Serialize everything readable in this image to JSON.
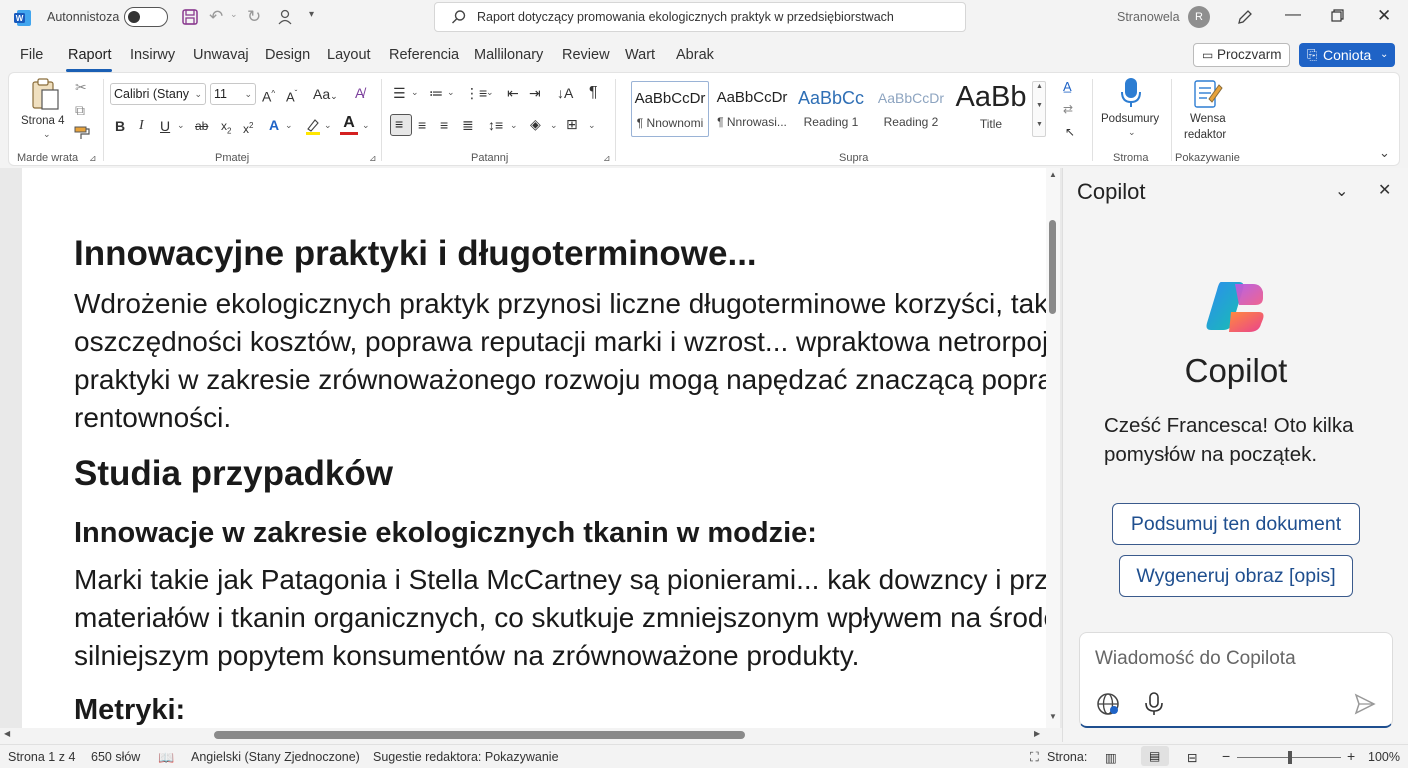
{
  "titlebar": {
    "autosave_label": "Autonnistoza",
    "search_text": "Raport dotyczący promowania ekologicznych praktyk w przedsiębiorstwach",
    "account_label": "Stranowela",
    "avatar_initial": "R"
  },
  "menu": {
    "tabs": [
      "File",
      "Raport",
      "Insirwy",
      "Unwavaj",
      "Design",
      "Layout",
      "Referencia",
      "Mallilonary",
      "Review",
      "Wart",
      "Abrak"
    ],
    "active_tab": "Raport",
    "comments_label": "Proczvarm",
    "share_label": "Coniota"
  },
  "ribbon": {
    "clipboard": {
      "paste_label": "Strona 4",
      "group_label": "Marde wrata"
    },
    "font": {
      "name": "Calibri (Stany",
      "size": "11",
      "group_label": "Pmatej"
    },
    "paragraph": {
      "group_label": "Patannj"
    },
    "styles": {
      "items": [
        {
          "preview": "AaBbCcDr",
          "name": "¶ Nnownomi"
        },
        {
          "preview": "AaBbCcDr",
          "name": "¶ Nnrowasi..."
        },
        {
          "preview": "AaBbCc",
          "name": "Reading 1"
        },
        {
          "preview": "AaBbCcDr",
          "name": "Reading 2"
        },
        {
          "preview": "AaBb",
          "name": "Title"
        }
      ],
      "group_label": "Supra"
    },
    "voice": {
      "label": "Podsumury",
      "group_label": "Stroma"
    },
    "editor": {
      "label_line1": "Wensa",
      "label_line2": "redaktor",
      "group_label": "Pokazywanie"
    }
  },
  "document": {
    "heading1": "Innowacyjne praktyki i długoterminowe...",
    "para1": [
      "Wdrożenie ekologicznych praktyk przynosi liczne długoterminowe korzyści, takie",
      "oszczędności kosztów, poprawa reputacji marki i wzrost... wpraktowa netrorpoji i",
      "praktyki w zakresie zrównoważonego rozwoju mogą napędzać znaczącą poprawę",
      "rentowności."
    ],
    "heading2": "Studia przypadków",
    "heading3": "Innowacje w zakresie ekologicznych tkanin w modzie:",
    "para2": [
      "Marki takie jak Patagonia i Stella McCartney są pionierami... kak dowzncy i przaty",
      "materiałów i tkanin organicznych, co skutkuje zmniejszonym wpływem na środow",
      "silniejszym popytem konsumentów na zrównoważone produkty."
    ],
    "heading4": "Metryki:"
  },
  "copilot": {
    "pane_title": "Copilot",
    "logo_title": "Copilot",
    "greeting_line1": "Cześć Francesca! Oto kilka",
    "greeting_line2": "pomysłów na początek.",
    "suggestion1": "Podsumuj ten dokument",
    "suggestion2": "Wygeneruj obraz [opis]",
    "input_placeholder": "Wiadomość do Copilota"
  },
  "statusbar": {
    "page": "Strona 1 z 4",
    "words": "650 słów",
    "language": "Angielski (Stany Zjednoczone)",
    "editor_suggestions": "Sugestie redaktora: Pokazywanie",
    "focus_label": "Strona:",
    "zoom": "100%"
  },
  "colors": {
    "accent": "#1f63c6",
    "tab_underline": "#1a5fb4",
    "copilot_border": "#3a5a8c"
  }
}
